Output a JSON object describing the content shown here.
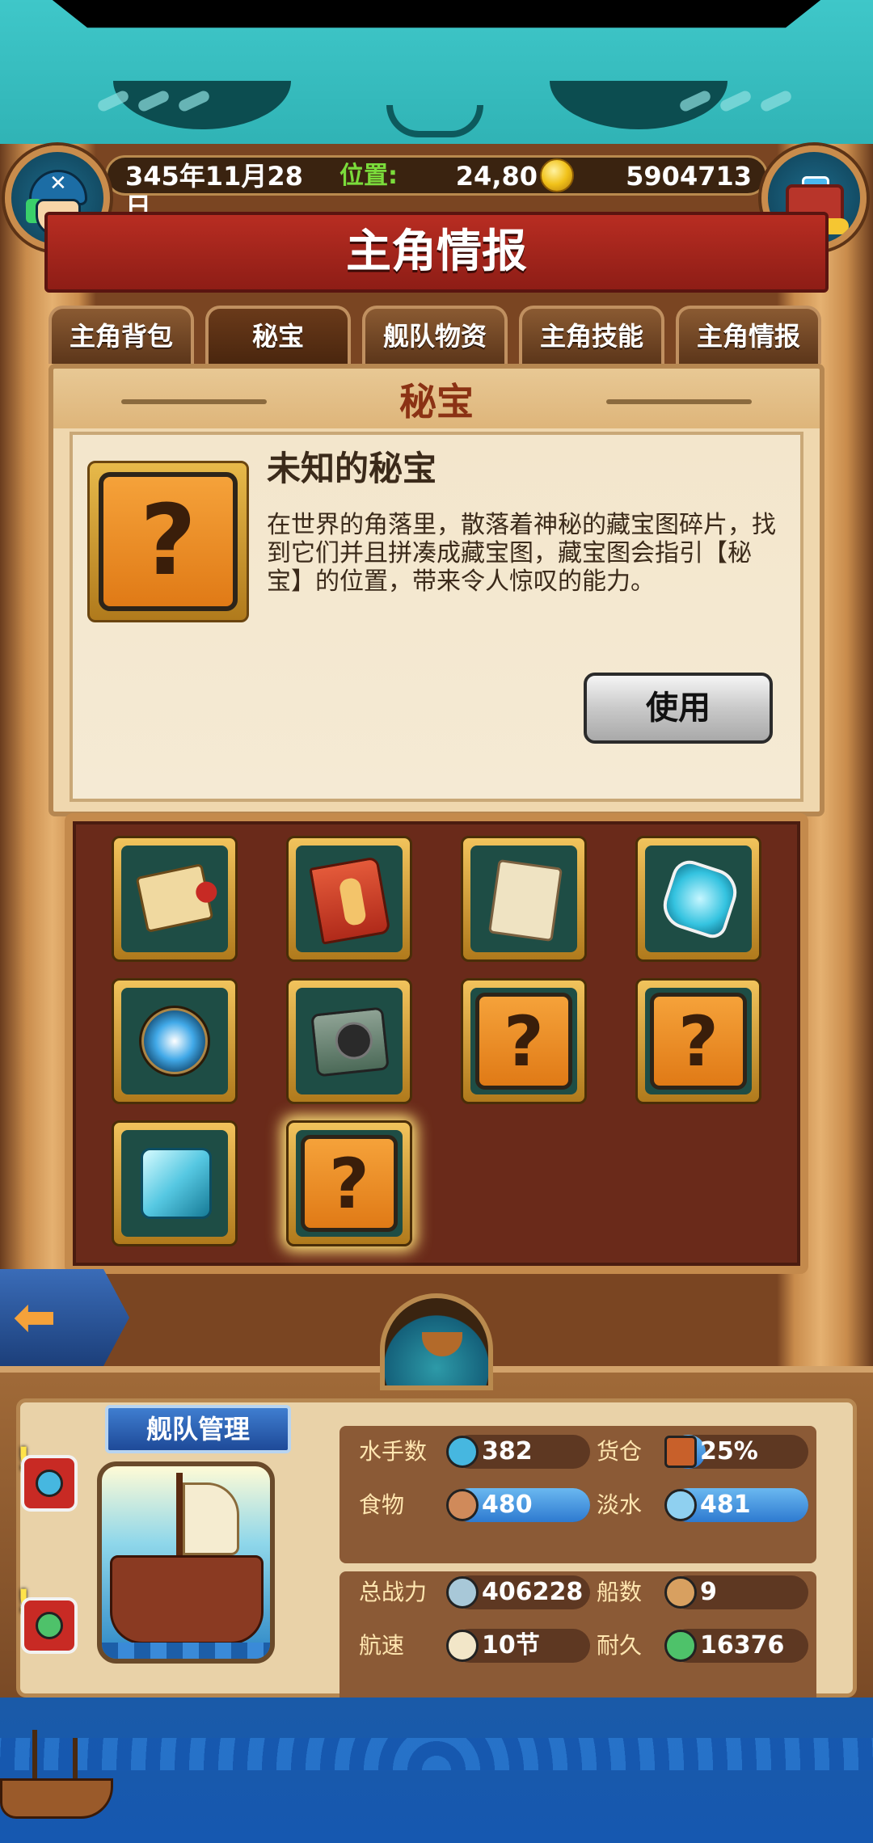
{
  "header": {
    "date": "345年11月28日",
    "position_label": "位置:",
    "position_value": "24,80",
    "gold": "5904713"
  },
  "title": "主角情报",
  "tabs": [
    {
      "label": "主角背包"
    },
    {
      "label": "秘宝",
      "active": true
    },
    {
      "label": "舰队物资"
    },
    {
      "label": "主角技能"
    },
    {
      "label": "主角情报"
    }
  ],
  "panel": {
    "title": "秘宝",
    "item_symbol": "?",
    "item_name": "未知的秘宝",
    "item_desc": "在世界的角落里，散落着神秘的藏宝图碎片，找到它们并且拼凑成藏宝图，藏宝图会指引【秘宝】的位置，带来令人惊叹的能力。",
    "use_button": "使用"
  },
  "grid": {
    "items": [
      {
        "icon": "treasure-map-icon"
      },
      {
        "icon": "red-book-icon"
      },
      {
        "icon": "scroll-icon"
      },
      {
        "icon": "crystal-icon"
      },
      {
        "icon": "compass-icon"
      },
      {
        "icon": "device-icon"
      },
      {
        "icon": "unknown-icon",
        "symbol": "?"
      },
      {
        "icon": "unknown-icon",
        "symbol": "?"
      },
      {
        "icon": "ice-cube-icon"
      },
      {
        "icon": "unknown-icon",
        "symbol": "?",
        "selected": true
      }
    ]
  },
  "fleet": {
    "title": "舰队管理",
    "excl": "!",
    "stats": {
      "sailors_label": "水手数",
      "sailors": "382",
      "cargo_label": "货仓",
      "cargo": "25%",
      "cargo_fraction": 0.25,
      "food_label": "食物",
      "food": "480",
      "water_label": "淡水",
      "water": "481",
      "power_label": "总战力",
      "power": "406228",
      "ships_label": "船数",
      "ships": "9",
      "speed_label": "航速",
      "speed": "10节",
      "durability_label": "耐久",
      "durability": "16376"
    }
  },
  "colors": {
    "teal": "#3fc7c9",
    "title_red": "#b82d22",
    "gold_text": "#7bdc3b",
    "fill_blue": "#2e7ad0"
  }
}
